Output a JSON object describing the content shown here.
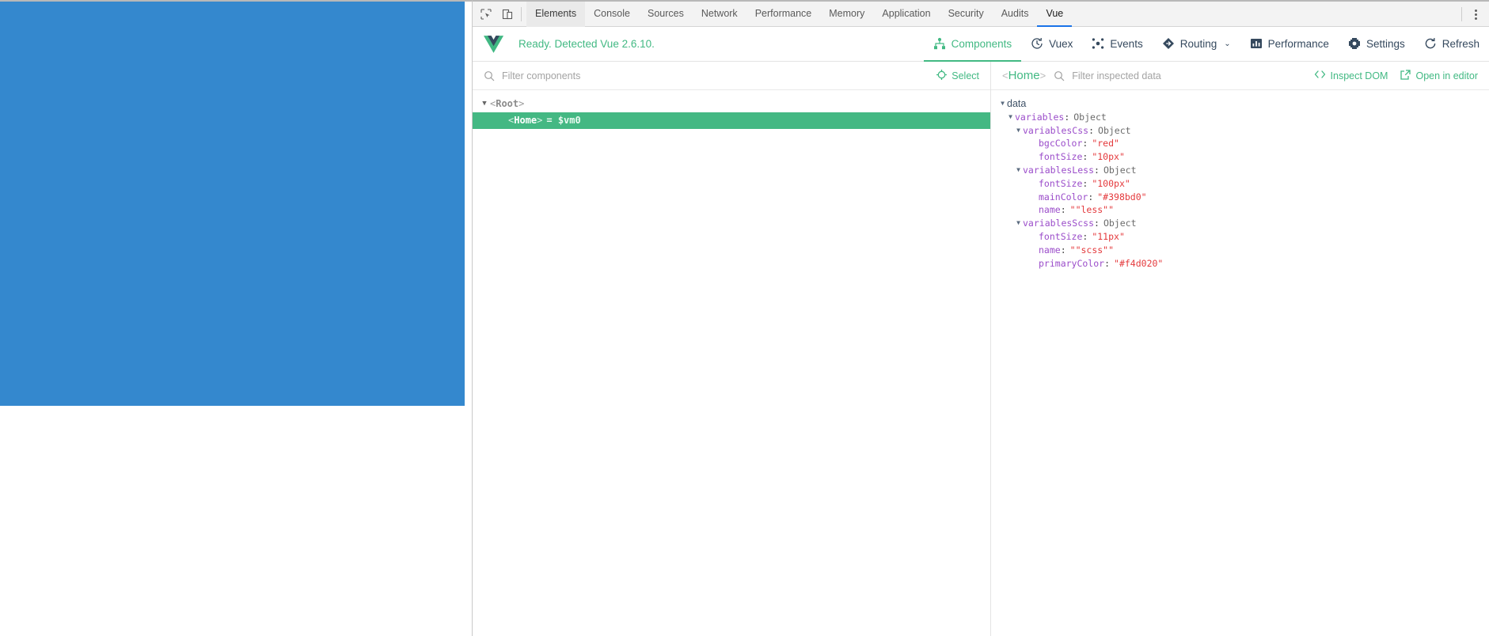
{
  "viewport": {
    "block_color": "#3488ce",
    "label": "rendered-page-blue-block"
  },
  "devtools": {
    "left_tools": [
      {
        "name": "inspect-element-icon",
        "title": "Inspect element"
      },
      {
        "name": "device-toolbar-icon",
        "title": "Toggle device toolbar"
      }
    ],
    "tabs": [
      {
        "label": "Elements",
        "selected": false
      },
      {
        "label": "Console",
        "selected": false
      },
      {
        "label": "Sources",
        "selected": false
      },
      {
        "label": "Network",
        "selected": false
      },
      {
        "label": "Performance",
        "selected": false
      },
      {
        "label": "Memory",
        "selected": false
      },
      {
        "label": "Application",
        "selected": false
      },
      {
        "label": "Security",
        "selected": false
      },
      {
        "label": "Audits",
        "selected": false
      },
      {
        "label": "Vue",
        "selected": true
      }
    ],
    "more_menu": "more-options-icon"
  },
  "vue_panel": {
    "logo": "vue-logo",
    "status": "Ready. Detected Vue 2.6.10.",
    "status_color": "#42b983",
    "actions": [
      {
        "label": "Components",
        "icon": "components-tree-icon",
        "active": true
      },
      {
        "label": "Vuex",
        "icon": "vuex-clock-icon",
        "active": false
      },
      {
        "label": "Events",
        "icon": "events-scatter-icon",
        "active": false
      },
      {
        "label": "Routing",
        "icon": "routing-diamond-icon",
        "active": false,
        "chevron": "⌄"
      },
      {
        "label": "Performance",
        "icon": "performance-bars-icon",
        "active": false
      },
      {
        "label": "Settings",
        "icon": "settings-gear-icon",
        "active": false
      },
      {
        "label": "Refresh",
        "icon": "refresh-icon",
        "active": false
      }
    ]
  },
  "tree_pane": {
    "search_icon": "search-icon",
    "filter_placeholder": "Filter components",
    "filter_value": "",
    "select_label": "Select",
    "select_icon": "target-icon",
    "nodes": [
      {
        "depth": 0,
        "arrow": "▼",
        "tag": "Root",
        "vm": "",
        "selected": false
      },
      {
        "depth": 1,
        "arrow": "",
        "tag": "Home",
        "vm": "= $vm0",
        "selected": true
      }
    ]
  },
  "inspect_pane": {
    "component_name": "Home",
    "search_icon": "search-icon",
    "filter_placeholder": "Filter inspected data",
    "filter_value": "",
    "inspect_dom_label": "Inspect DOM",
    "inspect_dom_icon": "code-brackets-icon",
    "open_editor_label": "Open in editor",
    "open_editor_icon": "external-link-icon",
    "rows": [
      {
        "indent": 0,
        "arrow": "▼",
        "key": "data",
        "root": true,
        "value": "",
        "type": ""
      },
      {
        "indent": 1,
        "arrow": "▼",
        "key": "variables",
        "root": false,
        "value": "Object",
        "type": "object"
      },
      {
        "indent": 2,
        "arrow": "▼",
        "key": "variablesCss",
        "root": false,
        "value": "Object",
        "type": "object"
      },
      {
        "indent": 4,
        "arrow": "",
        "key": "bgcColor",
        "root": false,
        "value": "\"red\"",
        "type": "string"
      },
      {
        "indent": 4,
        "arrow": "",
        "key": "fontSize",
        "root": false,
        "value": "\"10px\"",
        "type": "string"
      },
      {
        "indent": 2,
        "arrow": "▼",
        "key": "variablesLess",
        "root": false,
        "value": "Object",
        "type": "object"
      },
      {
        "indent": 4,
        "arrow": "",
        "key": "fontSize",
        "root": false,
        "value": "\"100px\"",
        "type": "string"
      },
      {
        "indent": 4,
        "arrow": "",
        "key": "mainColor",
        "root": false,
        "value": "\"#398bd0\"",
        "type": "string"
      },
      {
        "indent": 4,
        "arrow": "",
        "key": "name",
        "root": false,
        "value": "\"\"less\"\"",
        "type": "string"
      },
      {
        "indent": 2,
        "arrow": "▼",
        "key": "variablesScss",
        "root": false,
        "value": "Object",
        "type": "object"
      },
      {
        "indent": 4,
        "arrow": "",
        "key": "fontSize",
        "root": false,
        "value": "\"11px\"",
        "type": "string"
      },
      {
        "indent": 4,
        "arrow": "",
        "key": "name",
        "root": false,
        "value": "\"\"scss\"\"",
        "type": "string"
      },
      {
        "indent": 4,
        "arrow": "",
        "key": "primaryColor",
        "root": false,
        "value": "\"#f4d020\"",
        "type": "string"
      }
    ]
  }
}
